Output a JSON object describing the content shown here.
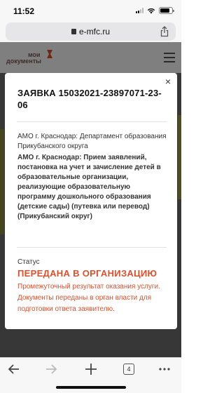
{
  "status_bar": {
    "time": "11:52"
  },
  "browser": {
    "url": "e-mfc.ru",
    "tabs_count": "4"
  },
  "site": {
    "logo_text_line1": "мои",
    "logo_text_line2": "документы"
  },
  "modal": {
    "title": "ЗАЯВКА 15032021-23897071-23-06",
    "department": "АМО г. Краснодар: Департамент образования Прикубанского округа",
    "service": "АМО г. Краснодар: Прием заявлений, постановка на учет и зачисление детей в образовательные организации, реализующие образовательную программу дошкольного образования (детские сады) (путевка или перевод) (Прикубанский округ)",
    "status_label": "Статус",
    "status_value": "ПЕРЕДАНА В ОРГАНИЗАЦИЮ",
    "status_description": "Промежуточный результат оказания услуги. Документы переданы в орган власти для подготовки ответа заявителю.",
    "close_symbol": "×"
  },
  "colors": {
    "accent": "#e04f2c",
    "logo": "#7a5a53"
  }
}
